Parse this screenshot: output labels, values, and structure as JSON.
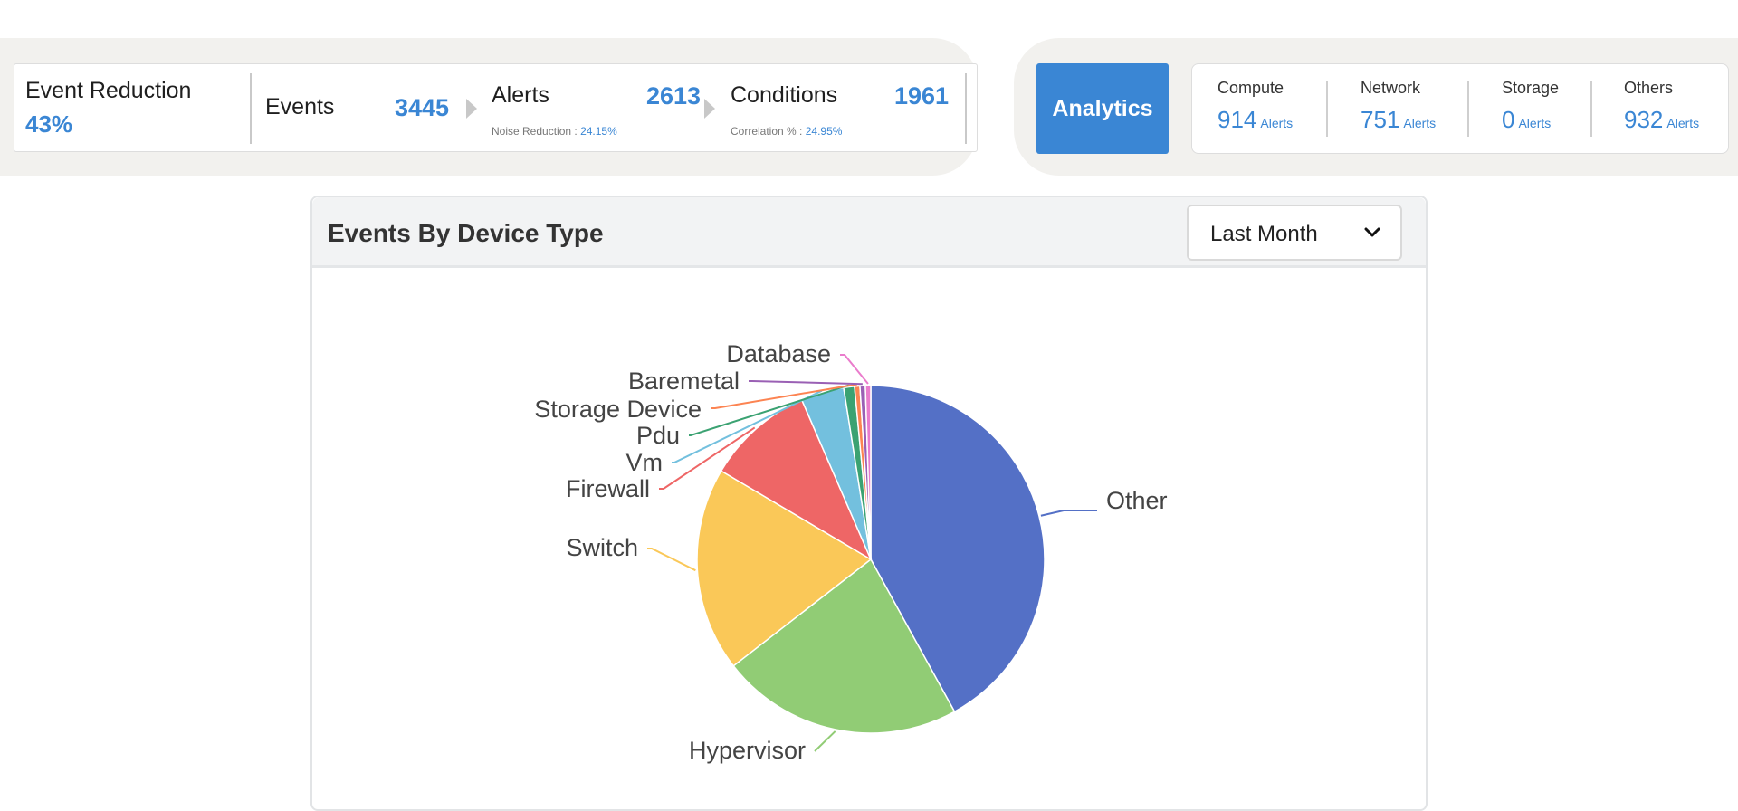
{
  "stats": {
    "event_reduction": {
      "label": "Event Reduction",
      "value": "43%"
    },
    "events": {
      "label": "Events",
      "value": "3445"
    },
    "alerts": {
      "label": "Alerts",
      "value": "2613",
      "sub_label": "Noise Reduction :",
      "sub_value": "24.15%"
    },
    "conditions": {
      "label": "Conditions",
      "value": "1961",
      "sub_label": "Correlation % :",
      "sub_value": "24.95%"
    }
  },
  "analytics": {
    "button_label": "Analytics",
    "categories": [
      {
        "label": "Compute",
        "value": "914",
        "unit": "Alerts"
      },
      {
        "label": "Network",
        "value": "751",
        "unit": "Alerts"
      },
      {
        "label": "Storage",
        "value": "0",
        "unit": "Alerts"
      },
      {
        "label": "Others",
        "value": "932",
        "unit": "Alerts"
      }
    ]
  },
  "panel": {
    "title": "Events By Device Type",
    "period": {
      "selected": "Last Month"
    }
  },
  "chart_data": {
    "type": "pie",
    "title": "",
    "slices": [
      {
        "name": "Other",
        "value": 42.0,
        "color": "#5470c6"
      },
      {
        "name": "Hypervisor",
        "value": 22.5,
        "color": "#91cc75"
      },
      {
        "name": "Switch",
        "value": 19.0,
        "color": "#fac858"
      },
      {
        "name": "Firewall",
        "value": 10.0,
        "color": "#ee6666"
      },
      {
        "name": "Vm",
        "value": 4.0,
        "color": "#73c0de"
      },
      {
        "name": "Pdu",
        "value": 1.0,
        "color": "#3ba272"
      },
      {
        "name": "Storage Device",
        "value": 0.5,
        "color": "#fc8452"
      },
      {
        "name": "Baremetal",
        "value": 0.5,
        "color": "#9a60b4"
      },
      {
        "name": "Database",
        "value": 0.5,
        "color": "#ea7ccc"
      }
    ]
  }
}
